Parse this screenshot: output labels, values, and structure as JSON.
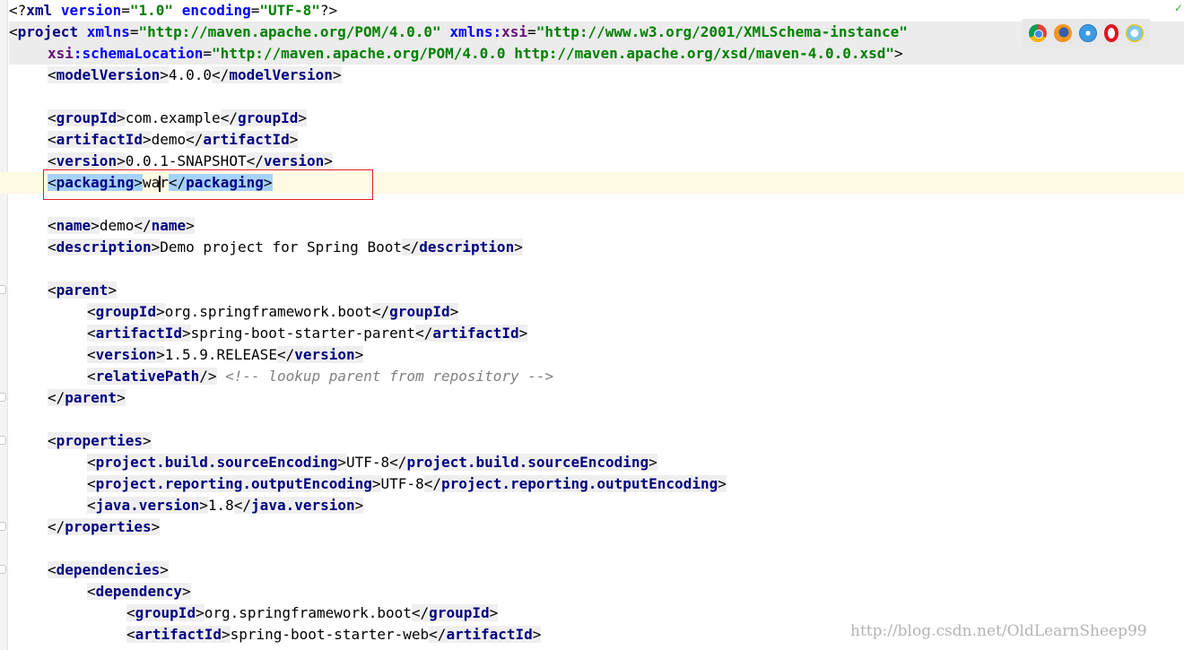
{
  "browser_icons": [
    "chrome-icon",
    "firefox-icon",
    "safari-icon",
    "opera-icon",
    "ie-icon"
  ],
  "lines": {
    "l1": {
      "open": "<?",
      "tag": "xml",
      "a1": "version",
      "v1": "\"1.0\"",
      "a2": "encoding",
      "v2": "\"UTF-8\"",
      "close": "?>"
    },
    "l2": {
      "open": "<",
      "tag": "project",
      "a1": "xmlns",
      "v1": "\"http://maven.apache.org/POM/4.0.0\"",
      "a2ns": "xmlns",
      "a2": "xsi",
      "v2": "\"http://www.w3.org/2001/XMLSchema-instance\""
    },
    "l3": {
      "ns": "xsi",
      "attr": "schemaLocation",
      "val": "\"http://maven.apache.org/POM/4.0.0 http://maven.apache.org/xsd/maven-4.0.0.xsd\"",
      "close": ">"
    },
    "modelVersion": {
      "tag": "modelVersion",
      "value": "4.0.0"
    },
    "groupId": {
      "tag": "groupId",
      "value": "com.example"
    },
    "artifactId": {
      "tag": "artifactId",
      "value": "demo"
    },
    "version": {
      "tag": "version",
      "value": "0.0.1-SNAPSHOT"
    },
    "packaging": {
      "tag": "packaging",
      "value_a": "wa",
      "value_b": "r"
    },
    "name": {
      "tag": "name",
      "value": "demo"
    },
    "description": {
      "tag": "description",
      "value": "Demo project for Spring Boot"
    },
    "parent_open": {
      "tag": "parent"
    },
    "parent_groupId": {
      "tag": "groupId",
      "value": "org.springframework.boot"
    },
    "parent_artifactId": {
      "tag": "artifactId",
      "value": "spring-boot-starter-parent"
    },
    "parent_version": {
      "tag": "version",
      "value": "1.5.9.RELEASE"
    },
    "relativePath": {
      "tag": "relativePath",
      "comment": "<!-- lookup parent from repository -->"
    },
    "parent_close": {
      "tag": "parent"
    },
    "properties_open": {
      "tag": "properties"
    },
    "prop_encoding": {
      "tag": "project.build.sourceEncoding",
      "value": "UTF-8"
    },
    "prop_output": {
      "tag": "project.reporting.outputEncoding",
      "value": "UTF-8"
    },
    "prop_java": {
      "tag": "java.version",
      "value": "1.8"
    },
    "properties_close": {
      "tag": "properties"
    },
    "dependencies_open": {
      "tag": "dependencies"
    },
    "dependency_open": {
      "tag": "dependency"
    },
    "dep_groupId": {
      "tag": "groupId",
      "value": "org.springframework.boot"
    },
    "dep_artifactId": {
      "tag": "artifactId",
      "value": "spring-boot-starter-web"
    }
  },
  "watermark": "http://blog.csdn.net/OldLearnSheep99"
}
